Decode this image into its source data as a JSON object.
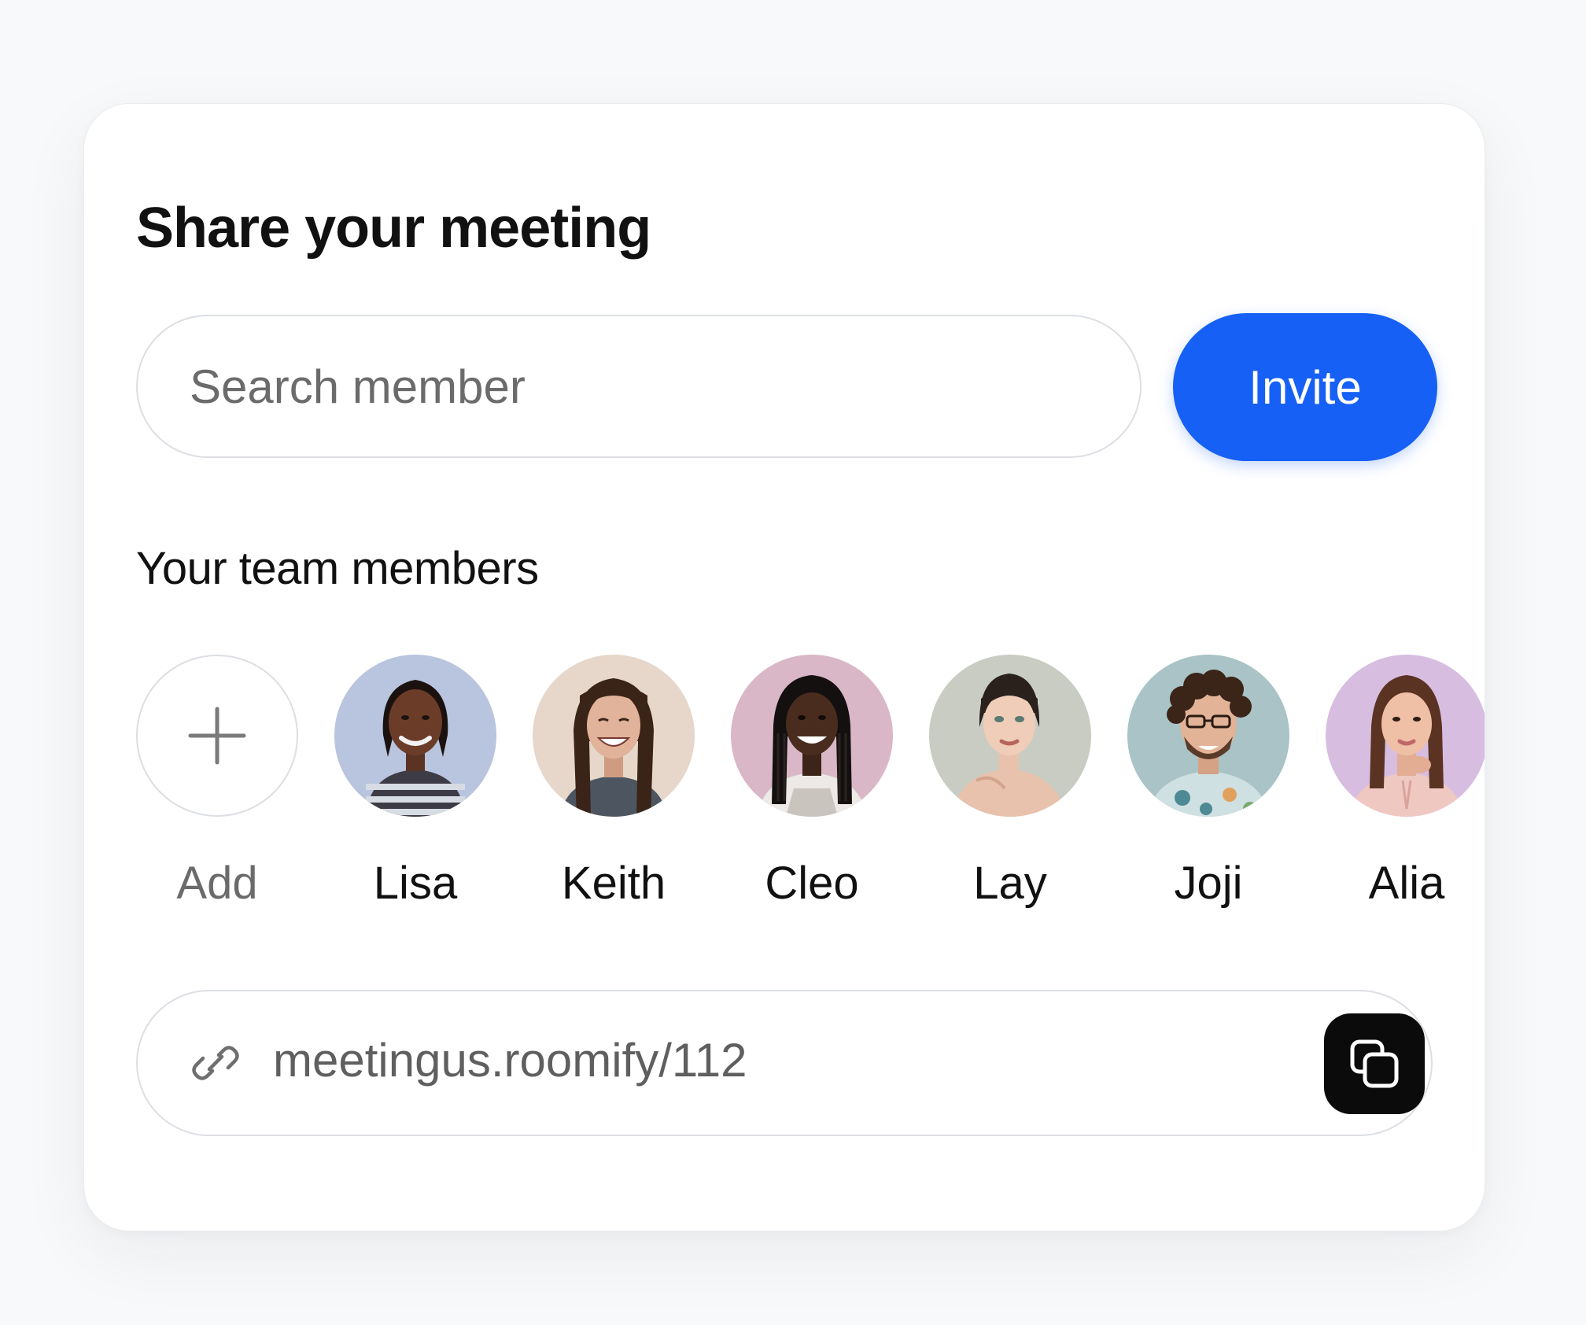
{
  "card": {
    "title": "Share your meeting"
  },
  "search": {
    "placeholder": "Search member",
    "value": ""
  },
  "invite_button": {
    "label": "Invite",
    "color": "#1660f5"
  },
  "team": {
    "title": "Your team members",
    "add_label": "Add",
    "members": [
      {
        "name": "Lisa",
        "avatar": "avatar-photo"
      },
      {
        "name": "Keith",
        "avatar": "avatar-photo"
      },
      {
        "name": "Cleo",
        "avatar": "avatar-photo"
      },
      {
        "name": "Lay",
        "avatar": "avatar-photo"
      },
      {
        "name": "Joji",
        "avatar": "avatar-photo"
      },
      {
        "name": "Alia",
        "avatar": "avatar-photo"
      }
    ]
  },
  "link": {
    "url": "meetingus.roomify/112",
    "icon": "link-icon",
    "copy_icon": "copy-icon"
  }
}
